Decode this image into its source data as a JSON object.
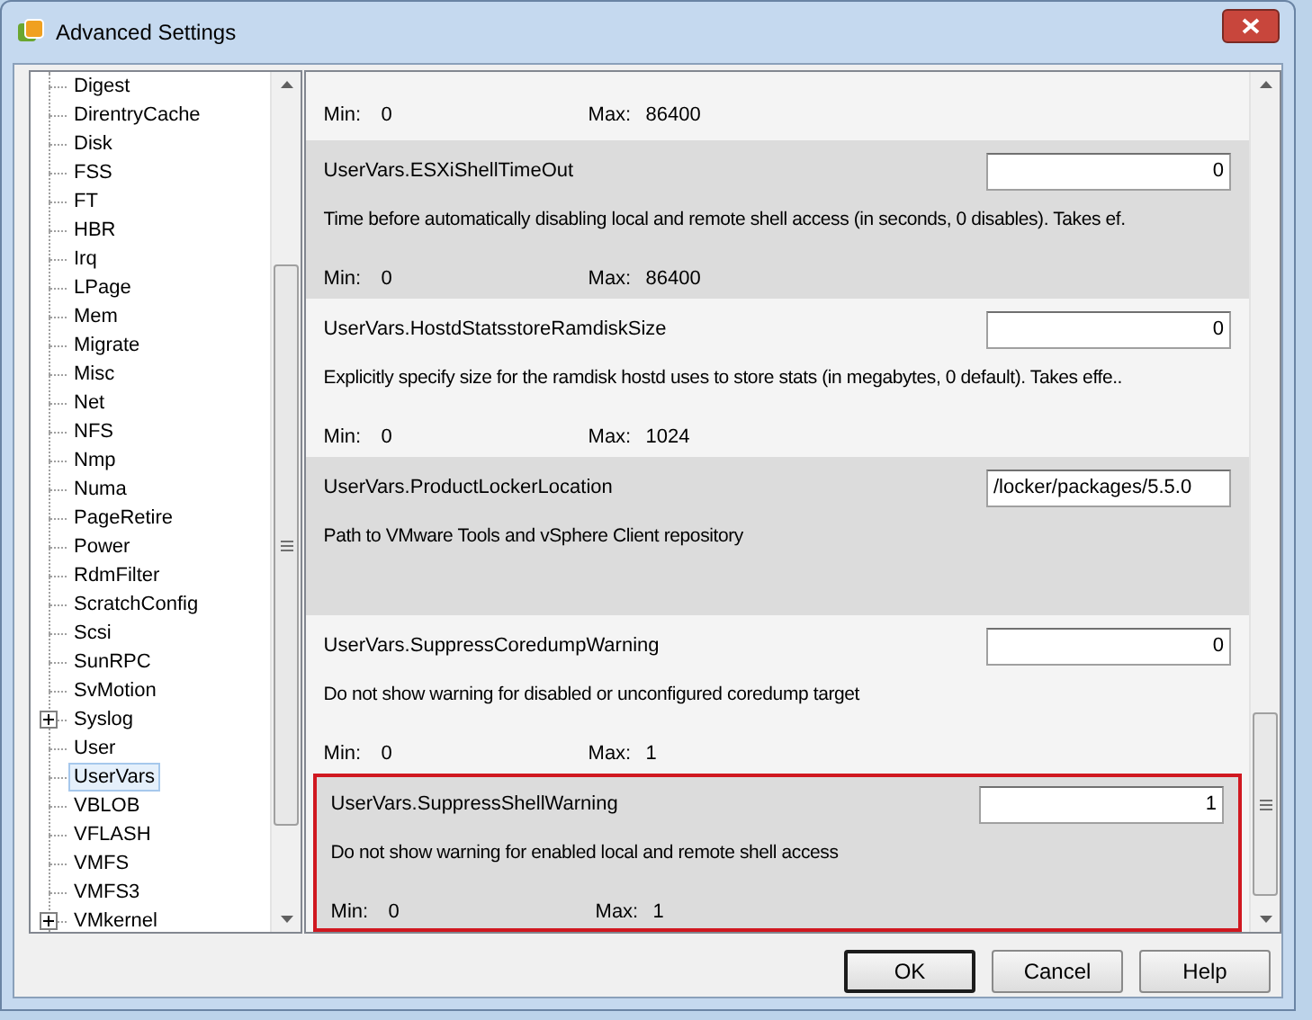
{
  "window": {
    "title": "Advanced Settings"
  },
  "tree": [
    {
      "label": "Digest",
      "expandable": false,
      "selected": false
    },
    {
      "label": "DirentryCache",
      "expandable": false,
      "selected": false
    },
    {
      "label": "Disk",
      "expandable": false,
      "selected": false
    },
    {
      "label": "FSS",
      "expandable": false,
      "selected": false
    },
    {
      "label": "FT",
      "expandable": false,
      "selected": false
    },
    {
      "label": "HBR",
      "expandable": false,
      "selected": false
    },
    {
      "label": "Irq",
      "expandable": false,
      "selected": false
    },
    {
      "label": "LPage",
      "expandable": false,
      "selected": false
    },
    {
      "label": "Mem",
      "expandable": false,
      "selected": false
    },
    {
      "label": "Migrate",
      "expandable": false,
      "selected": false
    },
    {
      "label": "Misc",
      "expandable": false,
      "selected": false
    },
    {
      "label": "Net",
      "expandable": false,
      "selected": false
    },
    {
      "label": "NFS",
      "expandable": false,
      "selected": false
    },
    {
      "label": "Nmp",
      "expandable": false,
      "selected": false
    },
    {
      "label": "Numa",
      "expandable": false,
      "selected": false
    },
    {
      "label": "PageRetire",
      "expandable": false,
      "selected": false
    },
    {
      "label": "Power",
      "expandable": false,
      "selected": false
    },
    {
      "label": "RdmFilter",
      "expandable": false,
      "selected": false
    },
    {
      "label": "ScratchConfig",
      "expandable": false,
      "selected": false
    },
    {
      "label": "Scsi",
      "expandable": false,
      "selected": false
    },
    {
      "label": "SunRPC",
      "expandable": false,
      "selected": false
    },
    {
      "label": "SvMotion",
      "expandable": false,
      "selected": false
    },
    {
      "label": "Syslog",
      "expandable": true,
      "selected": false
    },
    {
      "label": "User",
      "expandable": false,
      "selected": false
    },
    {
      "label": "UserVars",
      "expandable": false,
      "selected": true
    },
    {
      "label": "VBLOB",
      "expandable": false,
      "selected": false
    },
    {
      "label": "VFLASH",
      "expandable": false,
      "selected": false
    },
    {
      "label": "VMFS",
      "expandable": false,
      "selected": false
    },
    {
      "label": "VMFS3",
      "expandable": false,
      "selected": false
    },
    {
      "label": "VMkernel",
      "expandable": true,
      "selected": false
    }
  ],
  "settings": [
    {
      "min_label": "Min:",
      "min": "0",
      "max_label": "Max:",
      "max": "86400",
      "highlighted": false
    },
    {
      "name": "UserVars.ESXiShellTimeOut",
      "value": "0",
      "description": "Time before automatically disabling local and remote shell access (in seconds, 0 disables).  Takes ef.",
      "min_label": "Min:",
      "min": "0",
      "max_label": "Max:",
      "max": "86400",
      "highlighted": false
    },
    {
      "name": "UserVars.HostdStatsstoreRamdiskSize",
      "value": "0",
      "description": "Explicitly specify size for the ramdisk hostd uses to store stats (in megabytes, 0 default). Takes effe..",
      "min_label": "Min:",
      "min": "0",
      "max_label": "Max:",
      "max": "1024",
      "highlighted": false
    },
    {
      "name": "UserVars.ProductLockerLocation",
      "value": "/locker/packages/5.5.0",
      "kind": "text",
      "description": "Path to VMware Tools and vSphere Client repository",
      "highlighted": false
    },
    {
      "name": "UserVars.SuppressCoredumpWarning",
      "value": "0",
      "description": "Do not show warning for disabled or unconfigured coredump target",
      "min_label": "Min:",
      "min": "0",
      "max_label": "Max:",
      "max": "1",
      "highlighted": false
    },
    {
      "name": "UserVars.SuppressShellWarning",
      "value": "1",
      "description": "Do not show warning for enabled local and remote shell access",
      "min_label": "Min:",
      "min": "0",
      "max_label": "Max:",
      "max": "1",
      "highlighted": true
    }
  ],
  "buttons": [
    {
      "label": "OK",
      "default": true
    },
    {
      "label": "Cancel",
      "default": false
    },
    {
      "label": "Help",
      "default": false
    }
  ]
}
